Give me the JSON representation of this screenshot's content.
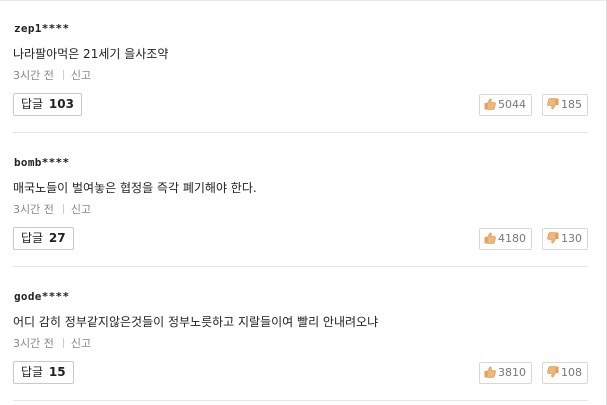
{
  "comments": [
    {
      "author": "zep1****",
      "text": "나라팔아먹은 21세기 을사조약",
      "time": "3시간 전",
      "report_label": "신고",
      "reply_label": "답글",
      "reply_count": "103",
      "likes": "5044",
      "dislikes": "185"
    },
    {
      "author": "bomb****",
      "text": "매국노들이 벌여놓은 협정을 즉각 폐기해야 한다.",
      "time": "3시간 전",
      "report_label": "신고",
      "reply_label": "답글",
      "reply_count": "27",
      "likes": "4180",
      "dislikes": "130"
    },
    {
      "author": "gode****",
      "text": "어디 감히 정부같지않은것들이 정부노릇하고 지랄들이여 빨리 안내려오냐",
      "time": "3시간 전",
      "report_label": "신고",
      "reply_label": "답글",
      "reply_count": "15",
      "likes": "3810",
      "dislikes": "108"
    }
  ],
  "colors": {
    "thumb_up": "#e0a060",
    "thumb_down": "#e0a060"
  },
  "icons": {
    "like": "thumbs-up-icon",
    "dislike": "thumbs-down-icon"
  }
}
